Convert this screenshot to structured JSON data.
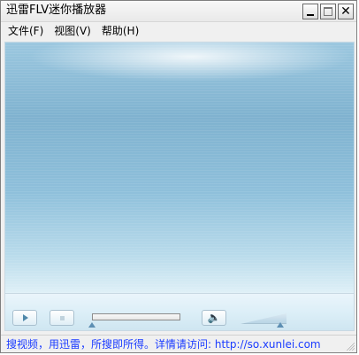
{
  "window": {
    "title": "迅雷FLV迷你播放器",
    "buttons": {
      "minimize_icon": "minimize-icon",
      "maximize_icon": "maximize-icon",
      "close_icon": "close-icon",
      "close_glyph": "✕"
    }
  },
  "menu": {
    "items": [
      {
        "label": "文件(F)"
      },
      {
        "label": "视图(V)"
      },
      {
        "label": "帮助(H)"
      }
    ]
  },
  "controls": {
    "play_icon": "play-icon",
    "stop_icon": "stop-icon",
    "volume_icon": "speaker-icon",
    "volume_glyph": "🔈",
    "progress": {
      "value": 0
    },
    "volume": {
      "value": 0.86
    }
  },
  "status": {
    "text": "搜视频，用迅雷，所搜即所得。详情请访问: http://so.xunlei.com"
  },
  "colors": {
    "status_text": "#1b3cff",
    "accent": "#5d8fb3"
  }
}
